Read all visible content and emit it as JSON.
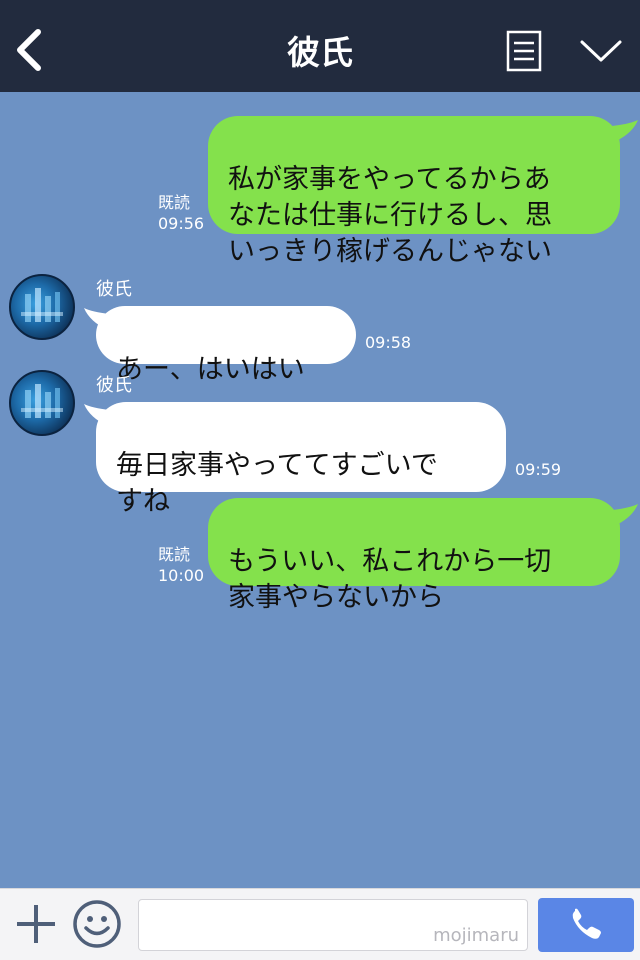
{
  "header": {
    "title": "彼氏",
    "icons": {
      "back": "chevron-left-icon",
      "menu": "notes-icon",
      "collapse": "chevron-down-icon"
    }
  },
  "messages": [
    {
      "side": "sent",
      "text": "私が家事をやってるからあ\nなたは仕事に行けるし、思\nいっきり稼げるんじゃない",
      "read": "既読",
      "time": "09:56"
    },
    {
      "side": "received",
      "sender": "彼氏",
      "text": "あー、はいはい",
      "time": "09:58"
    },
    {
      "side": "received",
      "sender": "彼氏",
      "text": "毎日家事やっててすごいで\nすね",
      "time": "09:59"
    },
    {
      "side": "sent",
      "text": "もういい、私これから一切\n家事やらないから",
      "read": "既読",
      "time": "10:00"
    }
  ],
  "footer": {
    "input_watermark": "mojimaru",
    "icons": {
      "plus": "plus-icon",
      "emoji": "smiley-icon",
      "call": "phone-icon"
    }
  },
  "colors": {
    "header_bg": "#222b3e",
    "chat_bg": "#6d92c4",
    "sent_bubble": "#84e14c",
    "recv_bubble": "#ffffff",
    "call_button": "#5a86e6"
  }
}
